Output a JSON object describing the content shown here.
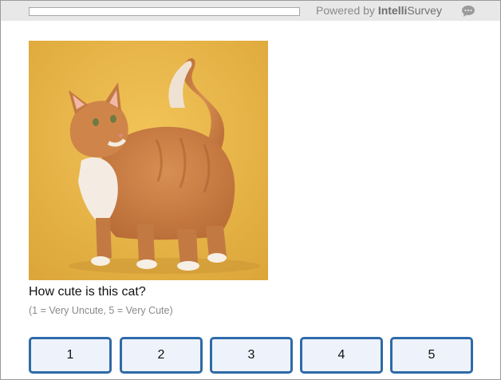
{
  "header": {
    "progress_fraction": 0,
    "powered_prefix": "Powered by ",
    "brand_bold": "Intelli",
    "brand_regular": "Survey",
    "chat_icon": "chat-bubble-icon"
  },
  "question": {
    "image_icon": "orange-cat-photo",
    "text": "How cute is this cat?",
    "hint": "(1 = Very Uncute, 5 = Very Cute)",
    "options": [
      "1",
      "2",
      "3",
      "4",
      "5"
    ]
  },
  "colors": {
    "option_border": "#2e6aa8",
    "option_fill": "#eef2fb",
    "photo_background": "#e9b84a"
  }
}
